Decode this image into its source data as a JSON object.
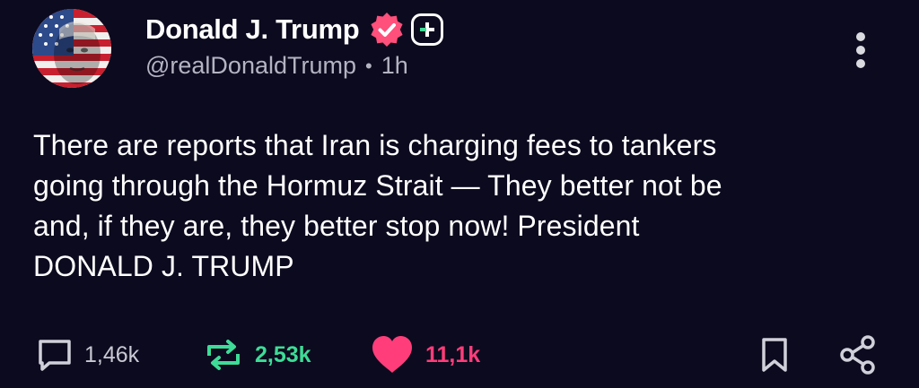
{
  "author": {
    "display_name": "Donald J. Trump",
    "handle": "@realDonaldTrump",
    "separator": "•",
    "time": "1h",
    "avatar_icon": "american-flag-portrait-avatar",
    "verified_icon": "verified-badge-icon",
    "plus_icon": "plus-badge-icon"
  },
  "post": {
    "text": "There are reports that Iran is charging fees to tankers\ngoing through the Hormuz Strait — They better not be\nand, if they are, they better stop now! President\nDONALD J. TRUMP"
  },
  "actions": {
    "reply_count": "1,46k",
    "repost_count": "2,53k",
    "like_count": "11,1k",
    "reply_icon": "comment-icon",
    "repost_icon": "repost-icon",
    "like_icon": "heart-icon",
    "bookmark_icon": "bookmark-icon",
    "share_icon": "share-icon",
    "more_icon": "more-vertical-icon"
  },
  "colors": {
    "background": "#0c0a1e",
    "text": "#ffffff",
    "muted": "#b3b3c2",
    "verified": "#ff4f7b",
    "repost_active": "#3ddc97",
    "like_active": "#ff3d7a"
  }
}
